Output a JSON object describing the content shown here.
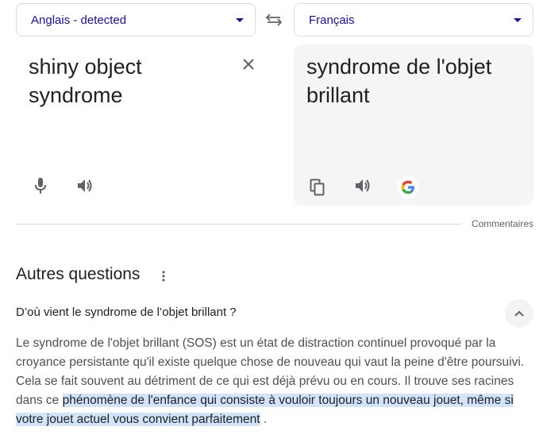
{
  "translator": {
    "source_language": "Anglais - detected",
    "target_language": "Français",
    "source_text": "shiny object syndrome",
    "translated_text": "syndrome de l'objet brillant",
    "feedback_label": "Commentaires"
  },
  "icons": {
    "swap": "swap-languages-icon",
    "clear": "close-icon",
    "mic": "microphone-icon",
    "speaker": "speaker-icon",
    "copy": "copy-icon",
    "google": "google-logo-icon"
  },
  "colors": {
    "link_blue": "#1a0dab",
    "highlight": "#d2e3fc",
    "panel_gray": "#f5f5f5"
  },
  "other_questions": {
    "title": "Autres questions",
    "items": [
      {
        "question": "D’où vient le syndrome de l’objet brillant ?",
        "answer_before": "Le syndrome de l'objet brillant (SOS) est un état de distraction continuel provoqué par la croyance persistante qu'il existe quelque chose de nouveau qui vaut la peine d'être poursuivi. Cela se fait souvent au détriment de ce qui est déjà prévu ou en cours. Il trouve ses racines dans ce ",
        "answer_highlight": "phénomène de l'enfance qui consiste à vouloir toujours un nouveau jouet, même si votre jouet actuel vous convient parfaitement",
        "answer_after": " ."
      }
    ]
  }
}
